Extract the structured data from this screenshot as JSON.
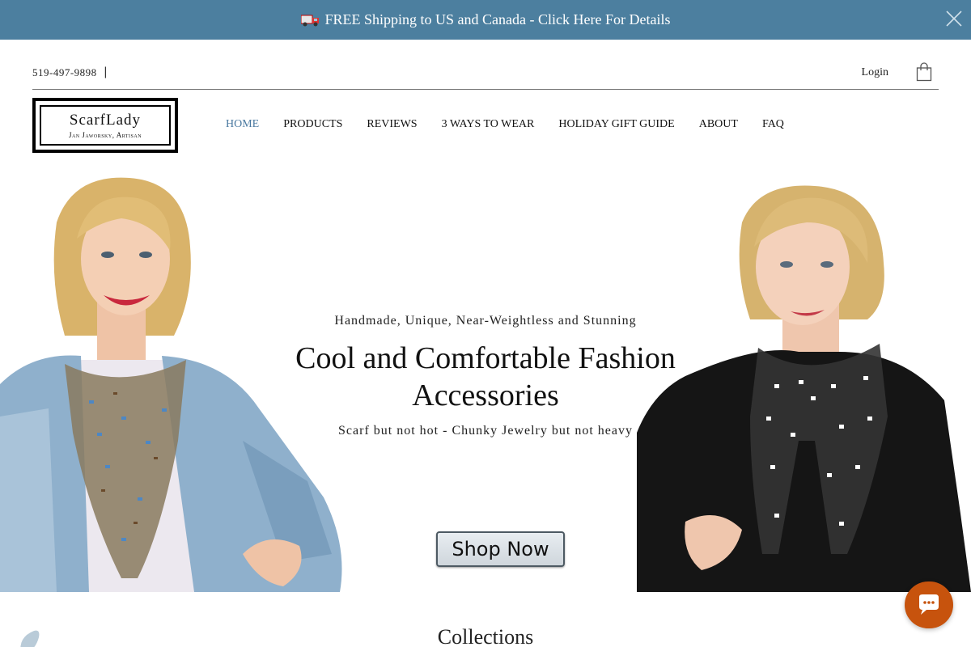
{
  "announcement": {
    "text": "FREE Shipping to US and Canada - Click Here For Details",
    "icon": "truck-icon",
    "background": "#4c7f9f"
  },
  "header": {
    "phone": "519-497-9898",
    "separator": "|",
    "login_label": "Login",
    "cart_icon": "shopping-bag-icon"
  },
  "logo": {
    "title": "ScarfLady",
    "subtitle": "Jan Jaworsky, Artisan"
  },
  "nav": {
    "items": [
      {
        "label": "HOME",
        "active": true
      },
      {
        "label": "PRODUCTS",
        "active": false
      },
      {
        "label": "REVIEWS",
        "active": false
      },
      {
        "label": "3 WAYS TO WEAR",
        "active": false
      },
      {
        "label": "HOLIDAY GIFT GUIDE",
        "active": false
      },
      {
        "label": "ABOUT",
        "active": false
      },
      {
        "label": "FAQ",
        "active": false
      }
    ],
    "active_color": "#4a79a0"
  },
  "hero": {
    "tagline": "Handmade, Unique, Near-Weightless and Stunning",
    "title": "Cool and Comfortable Fashion Accessories",
    "subtitle": "Scarf but not hot - Chunky Jewelry but not heavy",
    "button_label": "Shop Now"
  },
  "collections": {
    "title": "Collections"
  },
  "chat": {
    "icon": "chat-bubble-icon",
    "color": "#c7530d"
  }
}
